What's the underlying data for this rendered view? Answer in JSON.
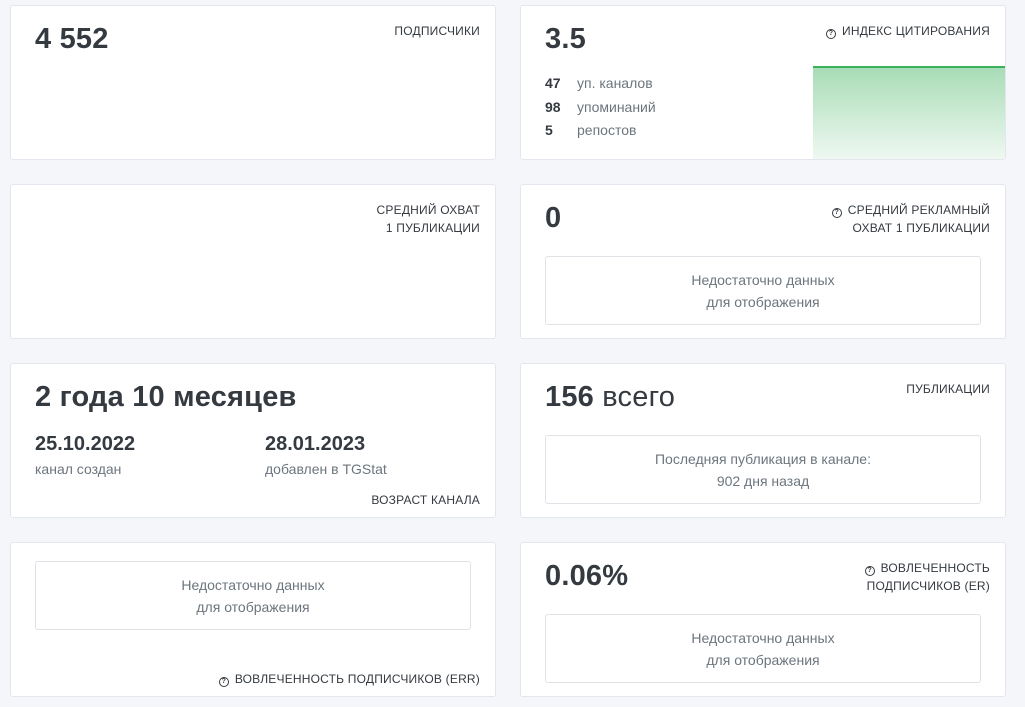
{
  "subscribers": {
    "value": "4 552",
    "label": "ПОДПИСЧИКИ"
  },
  "citation": {
    "value": "3.5",
    "label": "ИНДЕКС ЦИТИРОВАНИЯ",
    "info_icon": "question-circle-icon",
    "stats": [
      {
        "num": "47",
        "text": "уп. каналов"
      },
      {
        "num": "98",
        "text": "упоминаний"
      },
      {
        "num": "5",
        "text": "репостов"
      }
    ],
    "chart_color": "#3cb15b"
  },
  "avg_reach": {
    "label_line1": "СРЕДНИЙ ОХВАТ",
    "label_line2": "1 ПУБЛИКАЦИИ"
  },
  "avg_ad_reach": {
    "value": "0",
    "label_line1": "СРЕДНИЙ РЕКЛАМНЫЙ",
    "label_line2": "ОХВАТ 1 ПУБЛИКАЦИИ",
    "empty_line1": "Недостаточно данных",
    "empty_line2": "для отображения"
  },
  "age": {
    "value": "2 года 10 месяцев",
    "created_date": "25.10.2022",
    "created_label": "канал создан",
    "added_date": "28.01.2023",
    "added_label": "добавлен в TGStat",
    "label": "ВОЗРАСТ КАНАЛА"
  },
  "publications": {
    "value_num": "156",
    "value_word": "всего",
    "label": "ПУБЛИКАЦИИ",
    "last_line1": "Последняя публикация в канале:",
    "last_line2": "902 дня назад"
  },
  "err": {
    "empty_line1": "Недостаточно данных",
    "empty_line2": "для отображения",
    "label": "ВОВЛЕЧЕННОСТЬ ПОДПИСЧИКОВ (ERR)"
  },
  "er": {
    "value": "0.06%",
    "label_line1": "ВОВЛЕЧЕННОСТЬ",
    "label_line2": "ПОДПИСЧИКОВ (ER)",
    "empty_line1": "Недостаточно данных",
    "empty_line2": "для отображения"
  }
}
